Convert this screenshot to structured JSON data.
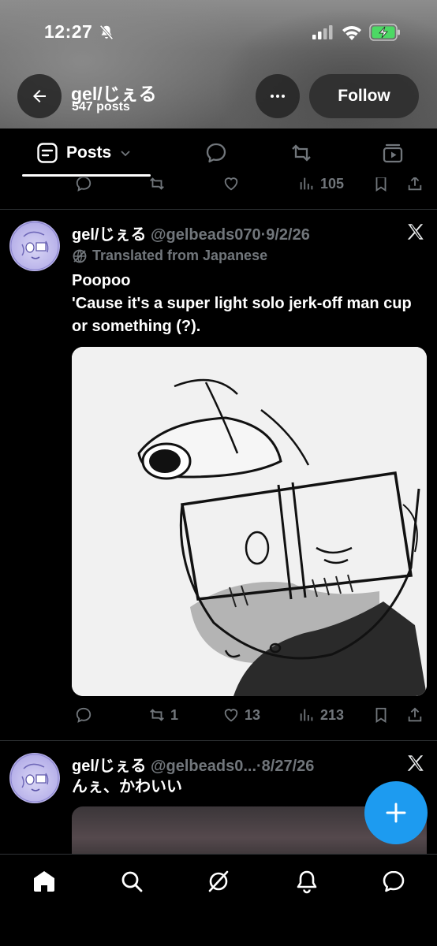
{
  "status_bar": {
    "time": "12:27"
  },
  "profile": {
    "name": "gel/じぇる",
    "post_count": "547 posts",
    "follow_label": "Follow"
  },
  "tabs": {
    "active_label": "Posts"
  },
  "previous_post": {
    "views": "105"
  },
  "post1": {
    "name": "gel/じぇる",
    "handle": "@gelbeads070",
    "date": "·9/2/26",
    "translated_label": "Translated from Japanese",
    "text_line1": "Poopoo",
    "text_line2": "'Cause it's a super light solo jerk-off man cup or something (?).",
    "reposts": "1",
    "likes": "13",
    "views": "213"
  },
  "post2": {
    "name": "gel/じぇる",
    "handle": "@gelbeads0...",
    "date": "·8/27/26",
    "text": "んぇ、かわいい"
  },
  "colors": {
    "accent": "#1d9bf0",
    "muted": "#71767b",
    "background": "#000000",
    "divider": "#2f3336"
  }
}
